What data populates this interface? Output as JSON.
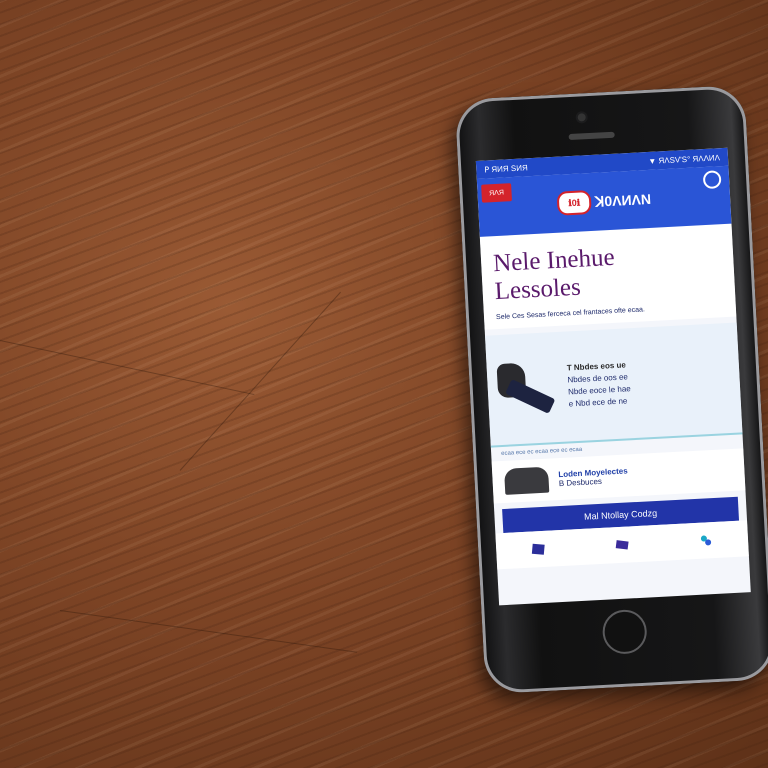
{
  "status_bar": {
    "left": "ꓑ ЯИЯ ЅИЯ",
    "right": "▼ ЯΛЅV'S° ЯΛΛИΛ"
  },
  "header": {
    "badge": "ЯΛЯ",
    "logo_mark": "ℹ0ℹ",
    "logo_text": "ꓘ0ΛИΛΝ"
  },
  "hero": {
    "title_line1": "Nele Inehue",
    "title_line2": "Lessoles",
    "subtitle": "Sele Ces Sesas ferceca cel frantaces ofte ecaa."
  },
  "feature": {
    "title": "T Nbdes eos ue",
    "lines": [
      "Nbdes de oos ee",
      "Nbde eoce le hae",
      "e Nbd ece de ne"
    ]
  },
  "feature_caption": "ecaa ece ec ecaa ece ec ecaa",
  "course": {
    "title": "Loden Moyelectes",
    "subtitle": "B Desbuces"
  },
  "cta": {
    "label": "Mal Ntollay Codzg"
  },
  "colors": {
    "brand": "#2a55d6",
    "accent": "#d4232b",
    "cta": "#2234a8",
    "hero_title": "#5a1a6b"
  },
  "icons": [
    "tab-icon-1",
    "tab-icon-2",
    "tab-icon-3"
  ]
}
